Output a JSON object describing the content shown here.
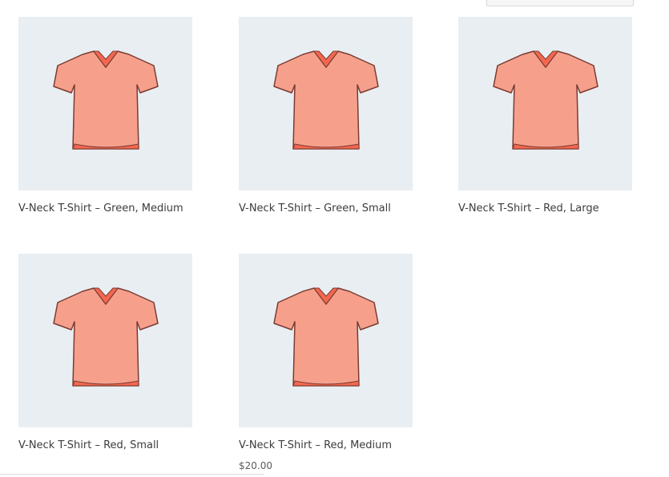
{
  "products": [
    {
      "title": "V-Neck T-Shirt – Green, Medium",
      "price": "",
      "image_icon": "tshirt-icon"
    },
    {
      "title": "V-Neck T-Shirt – Green, Small",
      "price": "",
      "image_icon": "tshirt-icon"
    },
    {
      "title": "V-Neck T-Shirt – Red, Large",
      "price": "",
      "image_icon": "tshirt-icon"
    },
    {
      "title": "V-Neck T-Shirt – Red, Small",
      "price": "",
      "image_icon": "tshirt-icon"
    },
    {
      "title": "V-Neck T-Shirt – Red, Medium",
      "price": "$20.00",
      "image_icon": "tshirt-icon"
    }
  ],
  "colors": {
    "shirt_body": "#f6a08c",
    "shirt_inner": "#f4674f",
    "thumb_bg": "#e9eef2"
  }
}
